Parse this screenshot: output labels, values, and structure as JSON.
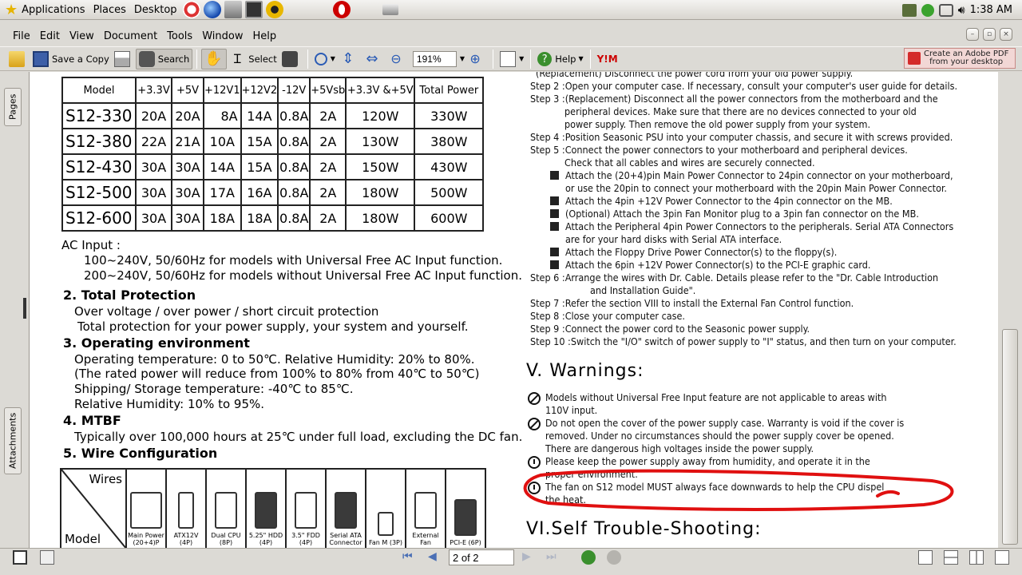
{
  "panel": {
    "menus": [
      "Applications",
      "Places",
      "Desktop"
    ],
    "clock": "1:38 AM"
  },
  "menubar": [
    "File",
    "Edit",
    "View",
    "Document",
    "Tools",
    "Window",
    "Help"
  ],
  "toolbar": {
    "save_copy": "Save a Copy",
    "search": "Search",
    "select": "Select",
    "zoom": "191%",
    "help": "Help",
    "adobe_line1": "Create an Adobe PDF",
    "adobe_line2": "from your desktop"
  },
  "sidetabs": {
    "pages": "Pages",
    "attachments": "Attachments"
  },
  "spec_table": {
    "headers": [
      "Model",
      "+3.3V",
      "+5V",
      "+12V1",
      "+12V2",
      "-12V",
      "+5Vsb",
      "+3.3V &+5V",
      "Total Power"
    ],
    "rows": [
      [
        "S12-330",
        "20A",
        "20A",
        "8A",
        "14A",
        "0.8A",
        "2A",
        "120W",
        "330W"
      ],
      [
        "S12-380",
        "22A",
        "21A",
        "10A",
        "15A",
        "0.8A",
        "2A",
        "130W",
        "380W"
      ],
      [
        "S12-430",
        "30A",
        "30A",
        "14A",
        "15A",
        "0.8A",
        "2A",
        "150W",
        "430W"
      ],
      [
        "S12-500",
        "30A",
        "30A",
        "17A",
        "16A",
        "0.8A",
        "2A",
        "180W",
        "500W"
      ],
      [
        "S12-600",
        "30A",
        "30A",
        "18A",
        "18A",
        "0.8A",
        "2A",
        "180W",
        "600W"
      ]
    ]
  },
  "left": {
    "ac_input": "AC Input :",
    "ac1": "100~240V, 50/60Hz for models with Universal Free AC Input function.",
    "ac2": "200~240V, 50/60Hz for models without Universal Free AC Input function.",
    "h2": "2. Total Protection",
    "p2a": "Over voltage / over power / short circuit protection",
    "p2b": "Total protection for your power supply, your system and yourself.",
    "h3": "3. Operating environment",
    "p3a": "Operating temperature: 0 to 50℃. Relative Humidity: 20% to 80%.",
    "p3b": "(The rated power will reduce from 100% to 80% from 40℃ to 50℃)",
    "p3c": "Shipping/ Storage temperature: -40℃ to 85℃.",
    "p3d": "Relative Humidity: 10% to 95%.",
    "h4": "4. MTBF",
    "p4": "Typically over 100,000 hours at 25℃ under full load, excluding the DC fan.",
    "h5": "5. Wire Configuration"
  },
  "wires": {
    "corner_top": "Wires",
    "corner_bottom": "Model",
    "cols": [
      "Main Power (20+4)P",
      "ATX12V (4P)",
      "Dual CPU (8P)",
      "5.25\" HDD (4P)",
      "3.5\" FDD (4P)",
      "Serial ATA Connector",
      "Fan M (3P)",
      "External Fan",
      "PCI-E (6P)"
    ]
  },
  "right": {
    "l0": "(Replacement) Disconnect the power cord from your old power supply.",
    "s2": "Step 2 :Open your computer case. If necessary, consult your computer's user guide for details.",
    "s3a": "Step 3 :(Replacement) Disconnect all the power connectors from the motherboard and the",
    "s3b": "peripheral devices.  Make sure that there are no devices connected to your old",
    "s3c": "power  supply.  Then remove the old power supply from your system.",
    "s4": "Step 4 :Position Seasonic PSU into your computer chassis, and secure it with screws provided.",
    "s5a": "Step 5 :Connect the power connectors to your motherboard and peripheral devices.",
    "s5b": "Check that all cables and wires are securely connected.",
    "b1a": "Attach the (20+4)pin Main Power Connector to 24pin connector on your motherboard,",
    "b1b": "or use the 20pin to connect your motherboard with the 20pin Main Power Connector.",
    "b2": "Attach the 4pin +12V Power Connector to the 4pin connector on the MB.",
    "b3": "(Optional) Attach the 3pin Fan Monitor plug to a 3pin fan connector on the MB.",
    "b4a": "Attach the Peripheral 4pin Power Connectors to the peripherals. Serial ATA Connectors",
    "b4b": "are for your hard disks with Serial ATA interface.",
    "b5": "Attach the Floppy Drive Power Connector(s) to the floppy(s).",
    "b6": "Attach the 6pin +12V Power Connector(s) to the PCI-E graphic card.",
    "s6a": "Step 6 :Arrange the wires with Dr. Cable. Details please refer to the \"Dr. Cable Introduction",
    "s6b": "and Installation Guide\".",
    "s7": "Step 7 :Refer the section VIII to install the External Fan Control function.",
    "s8": "Step 8 :Close your computer case.",
    "s9": "Step 9 :Connect the power cord to the Seasonic power supply.",
    "s10": "Step 10 :Switch the \"I/O\" switch of power supply to \"I\" status, and then turn on your computer.",
    "warn_title": "V. Warnings:",
    "w1a": "Models without Universal Free Input feature are not applicable to areas with",
    "w1b": "110V input.",
    "w2a": "Do not open the cover of the power supply case.  Warranty is void if the cover is",
    "w2b": "removed. Under no circumstances should the power supply cover be opened.",
    "w2c": "There are dangerous high voltages inside the power supply.",
    "w3a": "Please keep the power supply away from humidity, and operate it in the",
    "w3b": "proper environment.",
    "w4a": "The fan on S12 model MUST always face downwards to help the CPU dispel",
    "w4b": "the heat.",
    "trouble_title": "VI.Self Trouble-Shooting:"
  },
  "nav": {
    "page_indicator": "2 of 2"
  },
  "colors": {
    "annotation": "#e01010",
    "panel": "#d8d5cf"
  }
}
